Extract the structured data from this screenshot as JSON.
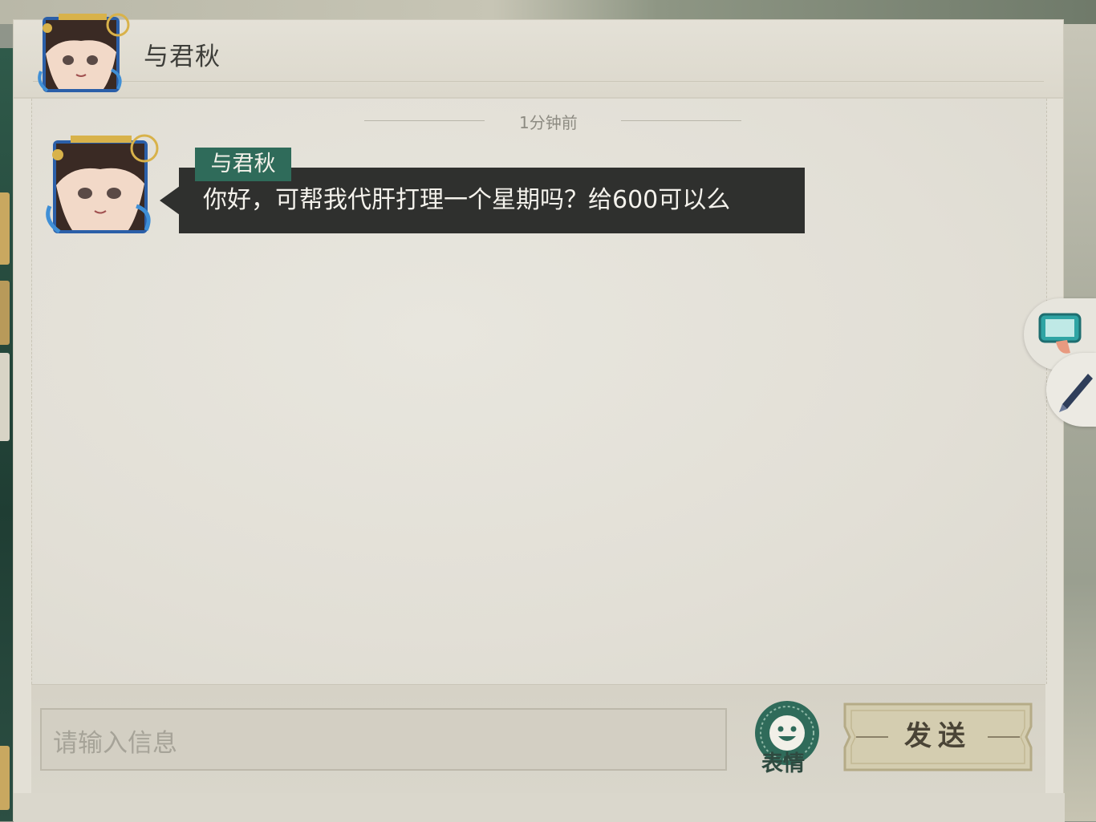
{
  "chat": {
    "contact_name": "与君秋",
    "timestamp": "1分钟前",
    "messages": [
      {
        "sender": "与君秋",
        "text": "你好，可帮我代肝打理一个星期吗？给600可以么"
      }
    ]
  },
  "composer": {
    "placeholder": "请输入信息",
    "emoji_label": "表情",
    "send_label": "发送"
  },
  "colors": {
    "panel_bg": "#e3e0d6",
    "name_tag": "#2f6b5a",
    "bubble": "#2f302e",
    "send_button": "#d4cdb0"
  },
  "icons": [
    "avatar-portrait",
    "smiley-icon",
    "tablet-icon",
    "pen-icon"
  ]
}
